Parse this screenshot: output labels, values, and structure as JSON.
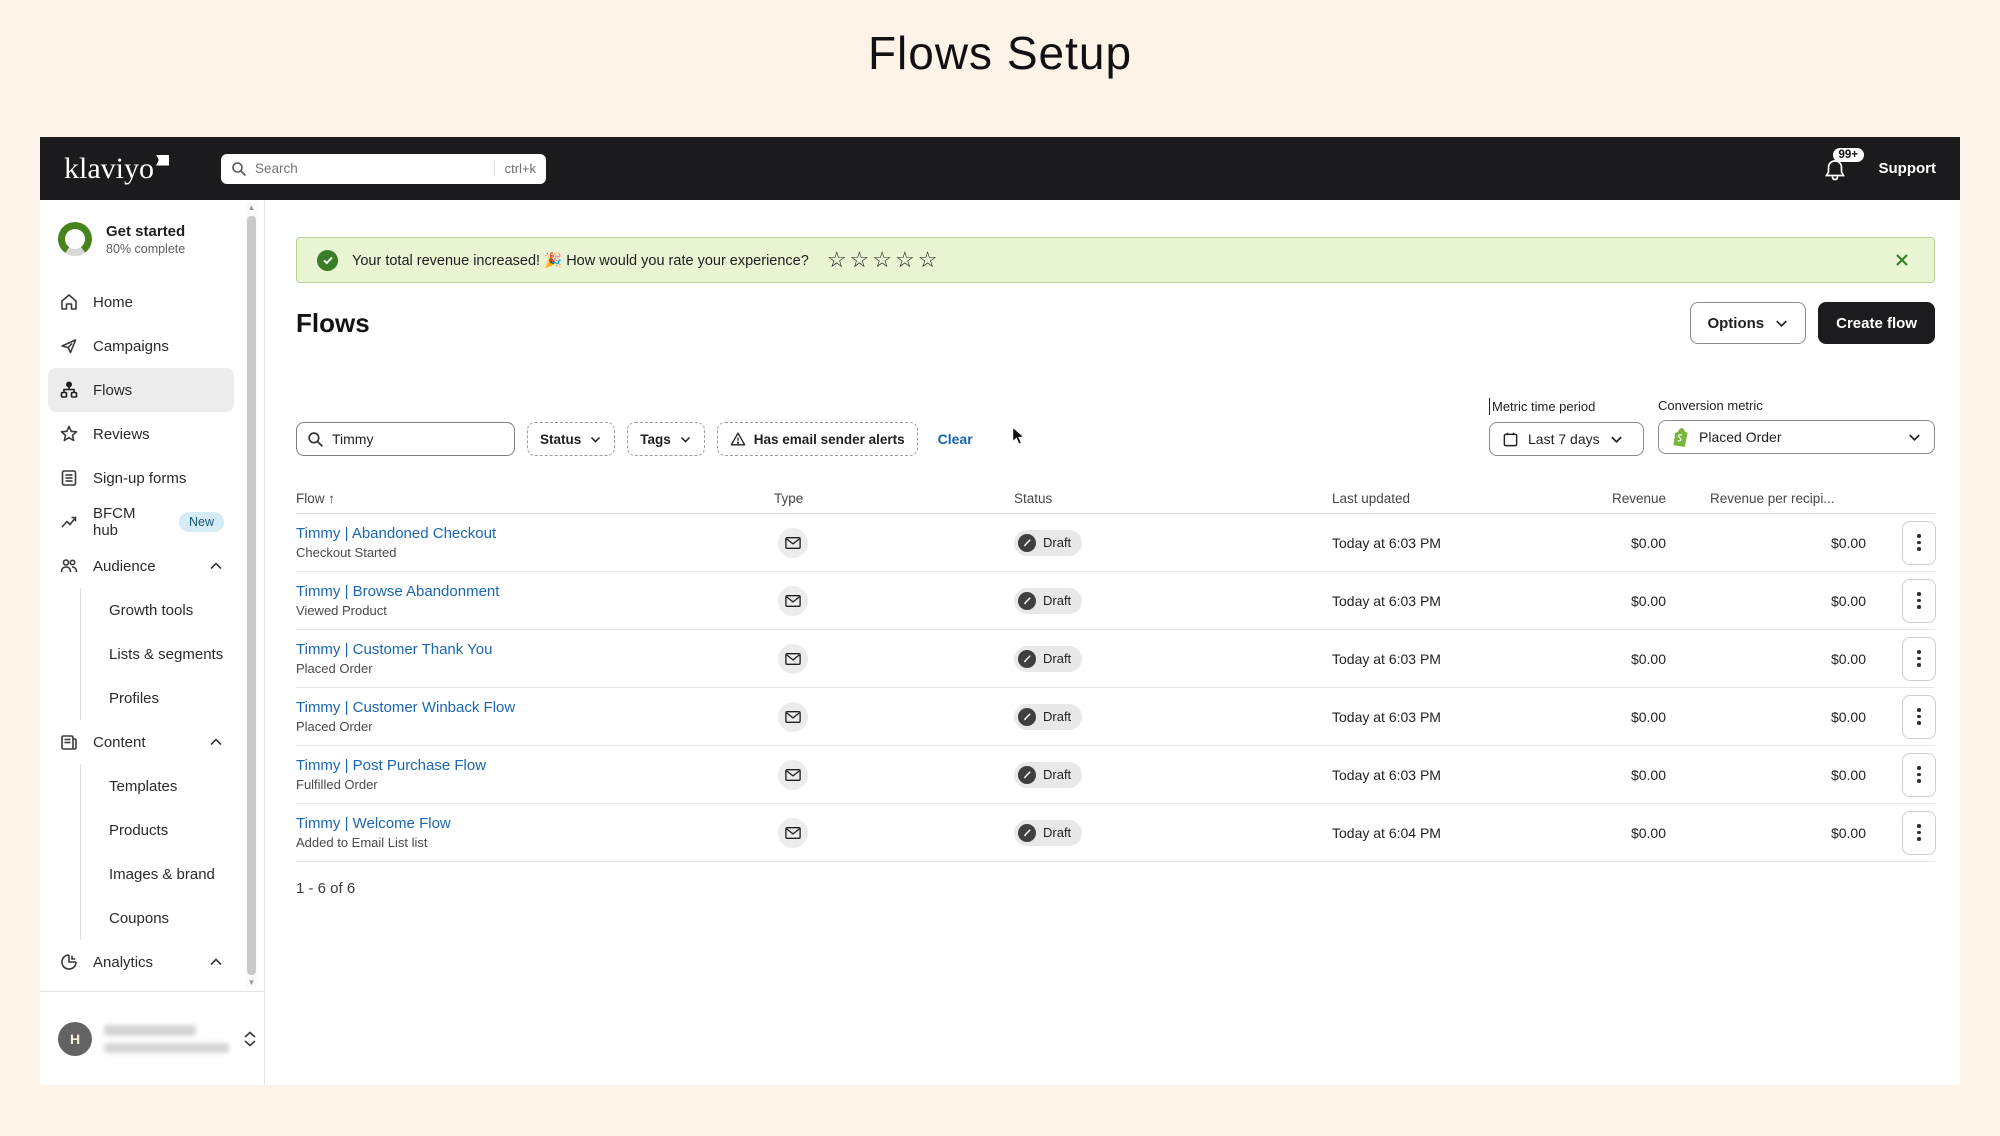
{
  "page_title": "Flows Setup",
  "colors": {
    "page_background": "#FDF3E8",
    "topbar": "#1B1B1D",
    "banner_background": "#E9F4D3",
    "banner_green": "#3A7D27",
    "link_blue": "#1A66B2",
    "active_nav_background": "#ECECEC",
    "new_badge_background": "#D5ECF6",
    "shopify_green": "#7AB53C"
  },
  "header": {
    "logo_text": "klaviyo",
    "search_placeholder": "Search",
    "search_shortcut": "ctrl+k",
    "notifications_badge": "99+",
    "support_label": "Support"
  },
  "sidebar": {
    "get_started": {
      "title": "Get started",
      "subtitle": "80% complete",
      "progress_percent": 80
    },
    "items": [
      {
        "label": "Home"
      },
      {
        "label": "Campaigns"
      },
      {
        "label": "Flows",
        "active": true
      },
      {
        "label": "Reviews"
      },
      {
        "label": "Sign-up forms"
      },
      {
        "label": "BFCM hub",
        "badge": "New"
      },
      {
        "label": "Audience",
        "expanded": true
      },
      {
        "label": "Content",
        "expanded": true
      },
      {
        "label": "Analytics",
        "expanded": true
      }
    ],
    "audience_subitems": [
      {
        "label": "Growth tools"
      },
      {
        "label": "Lists & segments"
      },
      {
        "label": "Profiles"
      }
    ],
    "content_subitems": [
      {
        "label": "Templates"
      },
      {
        "label": "Products"
      },
      {
        "label": "Images & brand"
      },
      {
        "label": "Coupons"
      }
    ],
    "user": {
      "initial": "H"
    }
  },
  "banner": {
    "message": "Your total revenue increased! 🎉 How would you rate your experience?",
    "stars": "☆☆☆☆☆"
  },
  "main": {
    "title": "Flows",
    "options_label": "Options",
    "create_flow_label": "Create flow",
    "filters": {
      "search_value": "Timmy",
      "status_label": "Status",
      "tags_label": "Tags",
      "alerts_label": "Has email sender alerts",
      "clear_label": "Clear"
    },
    "metric_time_period": {
      "label": "Metric time period",
      "value": "Last 7 days"
    },
    "conversion_metric": {
      "label": "Conversion metric",
      "value": "Placed Order"
    },
    "table": {
      "sort_arrow": "↑",
      "columns": [
        "Flow",
        "Type",
        "Status",
        "Last updated",
        "Revenue",
        "Revenue per recipi..."
      ],
      "rows": [
        {
          "name": "Timmy | Abandoned Checkout",
          "trigger": "Checkout Started",
          "type": "email",
          "status": "Draft",
          "last_updated": "Today at 6:03 PM",
          "revenue": "$0.00",
          "revenue_per_recipient": "$0.00"
        },
        {
          "name": "Timmy | Browse Abandonment",
          "trigger": "Viewed Product",
          "type": "email",
          "status": "Draft",
          "last_updated": "Today at 6:03 PM",
          "revenue": "$0.00",
          "revenue_per_recipient": "$0.00"
        },
        {
          "name": "Timmy | Customer Thank You",
          "trigger": "Placed Order",
          "type": "email",
          "status": "Draft",
          "last_updated": "Today at 6:03 PM",
          "revenue": "$0.00",
          "revenue_per_recipient": "$0.00"
        },
        {
          "name": "Timmy | Customer Winback Flow",
          "trigger": "Placed Order",
          "type": "email",
          "status": "Draft",
          "last_updated": "Today at 6:03 PM",
          "revenue": "$0.00",
          "revenue_per_recipient": "$0.00"
        },
        {
          "name": "Timmy | Post Purchase Flow",
          "trigger": "Fulfilled Order",
          "type": "email",
          "status": "Draft",
          "last_updated": "Today at 6:03 PM",
          "revenue": "$0.00",
          "revenue_per_recipient": "$0.00"
        },
        {
          "name": "Timmy | Welcome Flow",
          "trigger": "Added to Email List list",
          "type": "email",
          "status": "Draft",
          "last_updated": "Today at 6:04 PM",
          "revenue": "$0.00",
          "revenue_per_recipient": "$0.00"
        }
      ],
      "footer": "1 - 6 of 6"
    }
  }
}
